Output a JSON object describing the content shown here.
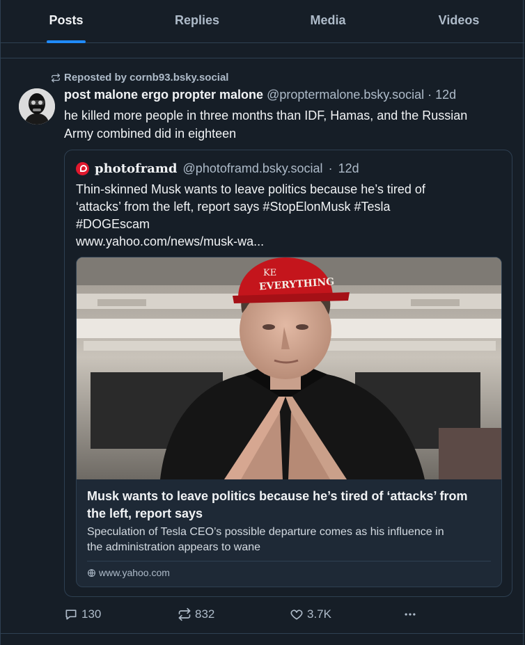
{
  "tabs": [
    {
      "label": "Posts",
      "active": true
    },
    {
      "label": "Replies",
      "active": false
    },
    {
      "label": "Media",
      "active": false
    },
    {
      "label": "Videos",
      "active": false
    }
  ],
  "post": {
    "repost_label": "Reposted by cornb93.bsky.social",
    "author_name": "post malone ergo propter malone",
    "author_handle": "@proptermalone.bsky.social",
    "separator": "·",
    "time": "12d",
    "text_lines": [
      "he killed more people in three months than IDF, Hamas, and the Russian",
      "Army combined did in eighteen"
    ],
    "quote": {
      "author_name": "photoframd",
      "author_handle": "@photoframd.bsky.social",
      "separator": "·",
      "time": "12d",
      "text_lines": [
        "Thin-skinned Musk wants to leave politics because he’s tired of",
        "‘attacks’ from the left, report says #StopElonMusk #Tesla",
        "#DOGEscam",
        "www.yahoo.com/news/musk-wa..."
      ],
      "card": {
        "image_hat_text_top": "KE",
        "image_hat_text": "EVERYTHING",
        "title_lines": [
          "Musk wants to leave politics because he’s tired of ‘attacks’ from",
          "the left, report says"
        ],
        "description_lines": [
          "Speculation of Tesla CEO’s possible departure comes as his influence in",
          "the administration appears to wane"
        ],
        "domain": "www.yahoo.com"
      }
    },
    "actions": {
      "replies": "130",
      "reposts": "832",
      "likes": "3.7K"
    }
  },
  "colors": {
    "background": "#161e27",
    "accent": "#208bfe",
    "border": "#2e4052",
    "muted_text": "#aebbc9"
  }
}
